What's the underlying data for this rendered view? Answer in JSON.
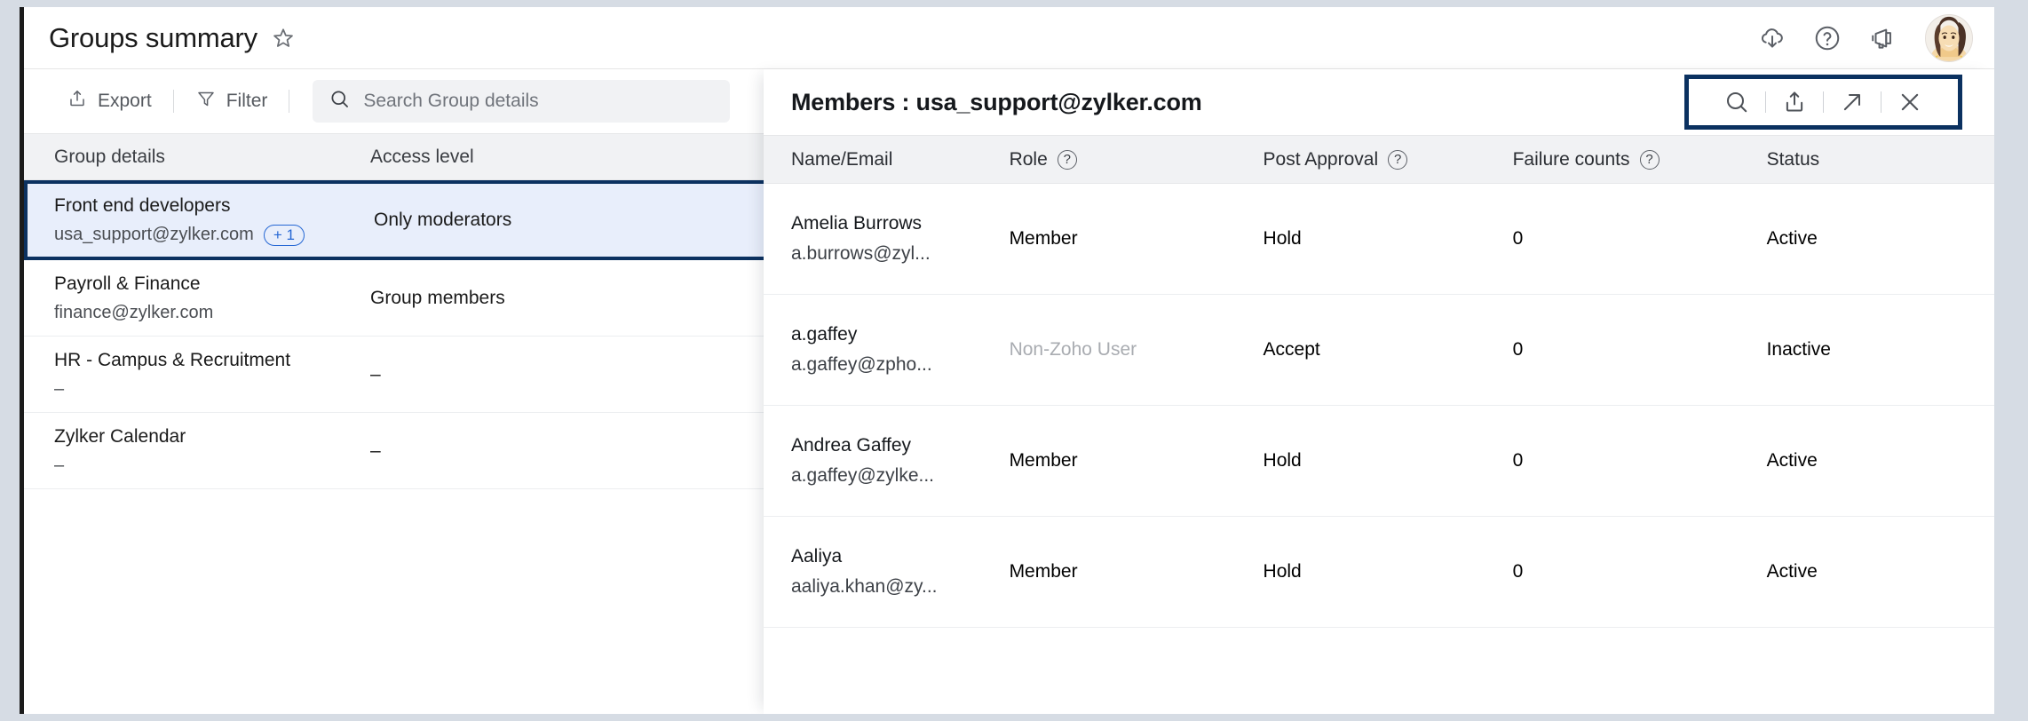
{
  "header": {
    "title": "Groups summary",
    "star_icon": "star-icon",
    "actions": [
      {
        "name": "cloud-download-icon"
      },
      {
        "name": "help-icon"
      },
      {
        "name": "announcement-icon"
      },
      {
        "name": "avatar"
      }
    ]
  },
  "toolbar": {
    "export_label": "Export",
    "filter_label": "Filter",
    "search_placeholder": "Search Group details"
  },
  "groups_table": {
    "columns": [
      "Group details",
      "Access level"
    ],
    "rows": [
      {
        "name": "Front end developers",
        "email": "usa_support@zylker.com",
        "badge": "+ 1",
        "access_level": "Only moderators",
        "selected": true
      },
      {
        "name": "Payroll & Finance",
        "email": "finance@zylker.com",
        "badge": "",
        "access_level": "Group members",
        "selected": false
      },
      {
        "name": "HR - Campus & Recruitment",
        "email": "–",
        "badge": "",
        "access_level": "–",
        "selected": false
      },
      {
        "name": "Zylker Calendar",
        "email": "–",
        "badge": "",
        "access_level": "–",
        "selected": false
      }
    ]
  },
  "members_panel": {
    "title": "Members : usa_support@zylker.com",
    "actions": [
      {
        "name": "search-icon"
      },
      {
        "name": "export-icon"
      },
      {
        "name": "expand-icon"
      },
      {
        "name": "close-icon"
      }
    ],
    "columns": [
      {
        "label": "Name/Email",
        "help": false
      },
      {
        "label": "Role",
        "help": true
      },
      {
        "label": "Post Approval",
        "help": true
      },
      {
        "label": "Failure counts",
        "help": true
      },
      {
        "label": "Status",
        "help": false
      }
    ],
    "rows": [
      {
        "name": "Amelia Burrows",
        "email": "a.burrows@zyl...",
        "role": "Member",
        "role_muted": false,
        "post_approval": "Hold",
        "failure_counts": "0",
        "status": "Active"
      },
      {
        "name": "a.gaffey",
        "email": "a.gaffey@zpho...",
        "role": "Non-Zoho User",
        "role_muted": true,
        "post_approval": "Accept",
        "failure_counts": "0",
        "status": "Inactive"
      },
      {
        "name": "Andrea Gaffey",
        "email": "a.gaffey@zylke...",
        "role": "Member",
        "role_muted": false,
        "post_approval": "Hold",
        "failure_counts": "0",
        "status": "Active"
      },
      {
        "name": "Aaliya",
        "email": "aaliya.khan@zy...",
        "role": "Member",
        "role_muted": false,
        "post_approval": "Hold",
        "failure_counts": "0",
        "status": "Active"
      }
    ]
  },
  "colors": {
    "highlight_box": "#0b3160",
    "selected_row_bg": "#e8eefb",
    "badge_blue": "#2567d4",
    "page_bg": "#d6dce4"
  }
}
